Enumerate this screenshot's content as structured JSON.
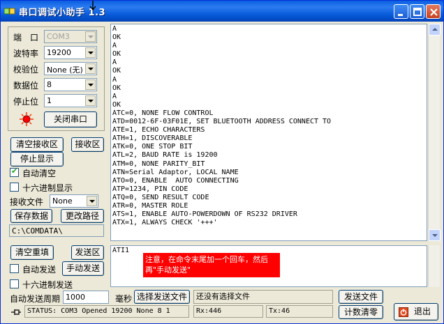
{
  "window": {
    "title": "串口调试小助手 1.3"
  },
  "settings": {
    "port_label": "端　口",
    "port_value": "COM3",
    "baud_label": "波特率",
    "baud_value": "19200",
    "parity_label": "校验位",
    "parity_value": "None (无)",
    "databits_label": "数据位",
    "databits_value": "8",
    "stopbits_label": "停止位",
    "stopbits_value": "1",
    "close_port_button": "关闭串口"
  },
  "receive_controls": {
    "clear_receive_button": "清空接收区",
    "receive_area_button": "接收区",
    "stop_display_button": "停止显示",
    "auto_clear_label": "自动清空",
    "auto_clear_checked": true,
    "hex_display_label": "十六进制显示",
    "hex_display_checked": false,
    "receive_file_label": "接收文件",
    "receive_file_value": "None",
    "save_data_button": "保存数据",
    "change_path_button": "更改路径",
    "path_value": "C:\\COMDATA\\"
  },
  "receive_text": [
    "A",
    "OK",
    "A",
    "OK",
    "A",
    "OK",
    "A",
    "OK",
    "A",
    "OK",
    "ATC=0, NONE FLOW CONTROL",
    "ATD=0012-6F-03F01E, SET BLUETOOTH ADDRESS CONNECT TO",
    "ATE=1, ECHO CHARACTERS",
    "ATH=1, DISCOVERABLE",
    "ATK=0, ONE STOP BIT",
    "ATL=2, BAUD RATE is 19200",
    "ATM=0, NONE PARITY_BIT",
    "ATN=Serial Adaptor, LOCAL NAME",
    "ATO=0, ENABLE  AUTO CONNECTING",
    "ATP=1234, PIN CODE",
    "ATQ=0, SEND RESULT CODE",
    "ATR=0, MASTER ROLE",
    "ATS=1, ENABLE AUTO-POWERDOWN OF RS232 DRIVER",
    "ATX=1, ALWAYS CHECK '+++'"
  ],
  "send_controls": {
    "clear_resend_button": "清空重填",
    "send_area_button": "发送区",
    "auto_send_label": "自动发送",
    "auto_send_checked": false,
    "manual_send_button": "手动发送",
    "hex_send_label": "十六进制发送",
    "hex_send_checked": false,
    "period_label": "自动发送周期",
    "period_value": "1000",
    "ms_label": "毫秒",
    "choose_file_button": "选择发送文件",
    "file_status": "还没有选择文件",
    "send_file_button": "发送文件",
    "reset_count_button": "计数清零",
    "exit_button": "退出"
  },
  "send_text": "ATI1",
  "annotation": {
    "line1": "注意，在命令末尾加一个回车，然后",
    "line2": "再\"手动发送\""
  },
  "status_bar": {
    "status": "STATUS: COM3 Opened 19200 None  8 1",
    "rx": "Rx:446",
    "tx": "Tx:46"
  },
  "colors": {
    "title_bar": "#0a5ee0",
    "annotation_bg": "#ff0000",
    "indicator": "#ff0000"
  }
}
